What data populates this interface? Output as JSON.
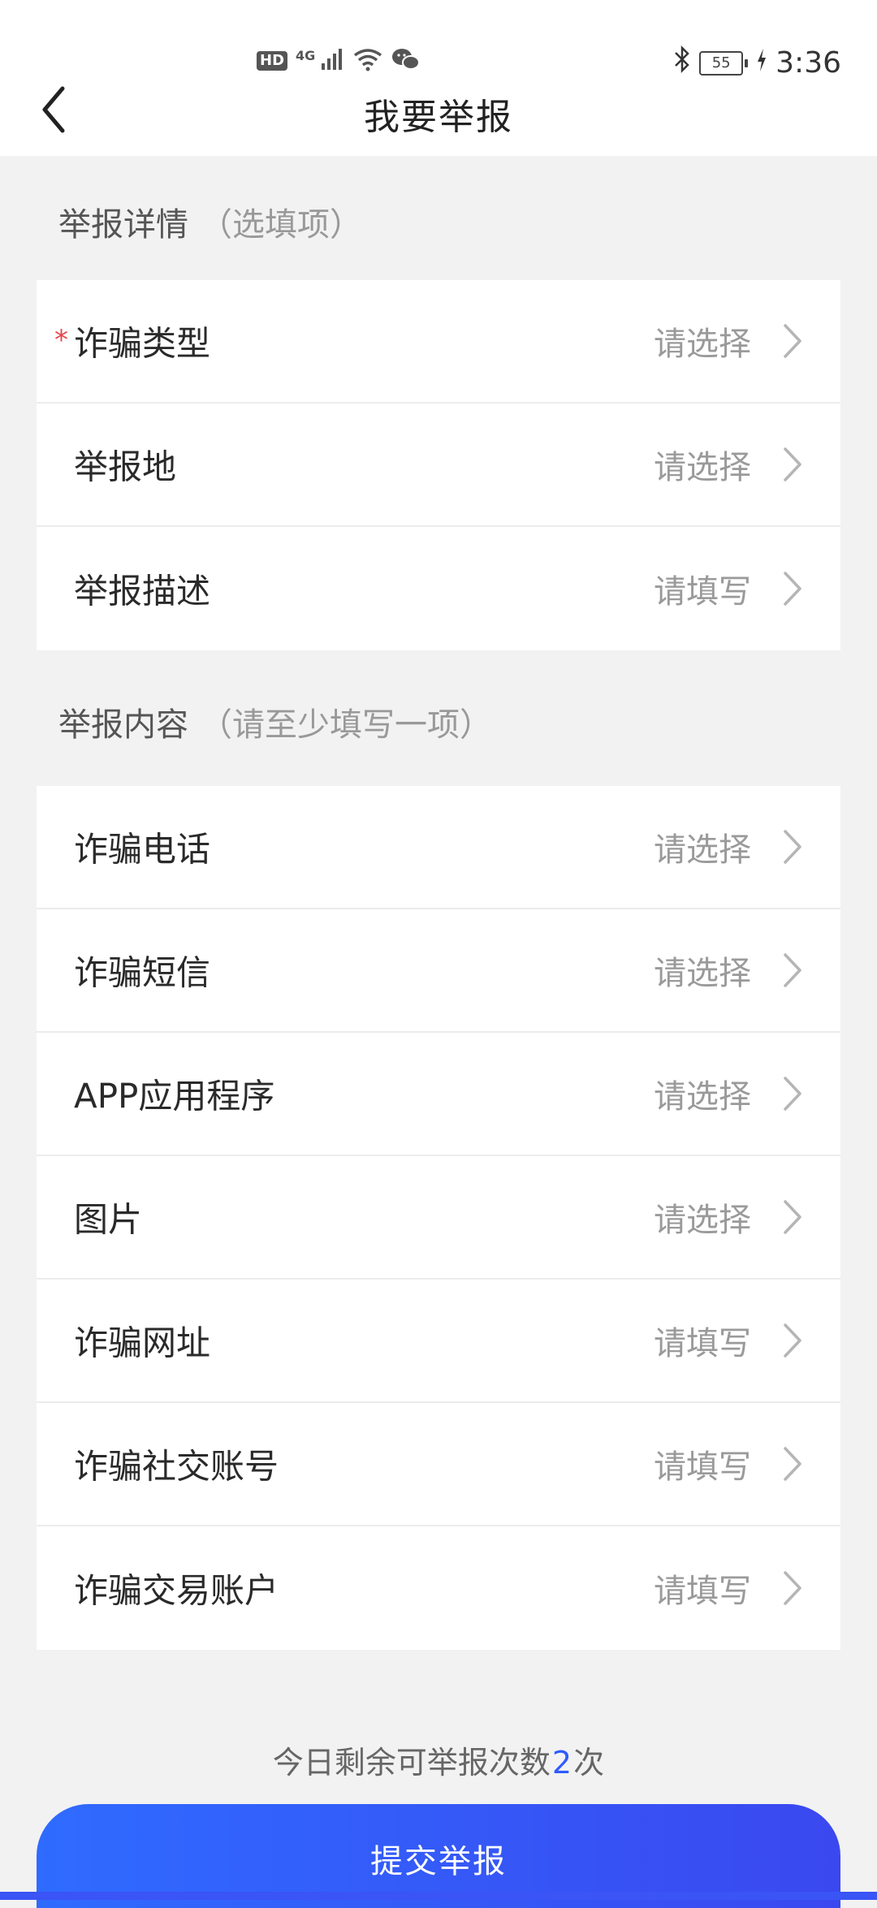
{
  "status_bar": {
    "hd": "HD",
    "net_type": "4G",
    "battery": "55",
    "time": "3:36",
    "icons": [
      "signal-icon",
      "wifi-icon",
      "wechat-icon",
      "bluetooth-icon",
      "charging-icon"
    ]
  },
  "header": {
    "title": "我要举报",
    "back_icon": "chevron-left-icon"
  },
  "sections": {
    "details": {
      "title": "举报详情",
      "hint": "（选填项）",
      "rows": [
        {
          "label": "诈骗类型",
          "value": "请选择",
          "required": true
        },
        {
          "label": "举报地",
          "value": "请选择"
        },
        {
          "label": "举报描述",
          "value": "请填写"
        }
      ]
    },
    "content": {
      "title": "举报内容",
      "hint": "（请至少填写一项）",
      "rows": [
        {
          "label": "诈骗电话",
          "value": "请选择"
        },
        {
          "label": "诈骗短信",
          "value": "请选择"
        },
        {
          "label": "APP应用程序",
          "value": "请选择"
        },
        {
          "label": "图片",
          "value": "请选择"
        },
        {
          "label": "诈骗网址",
          "value": "请填写"
        },
        {
          "label": "诈骗社交账号",
          "value": "请填写"
        },
        {
          "label": "诈骗交易账户",
          "value": "请填写"
        }
      ]
    }
  },
  "footer": {
    "remaining_prefix": "今日剩余可举报次数",
    "remaining_count": "2",
    "remaining_suffix": "次",
    "submit_label": "提交举报"
  },
  "colors": {
    "accent": "#2f5bff",
    "required": "#e5484d",
    "background": "#f2f2f2"
  }
}
